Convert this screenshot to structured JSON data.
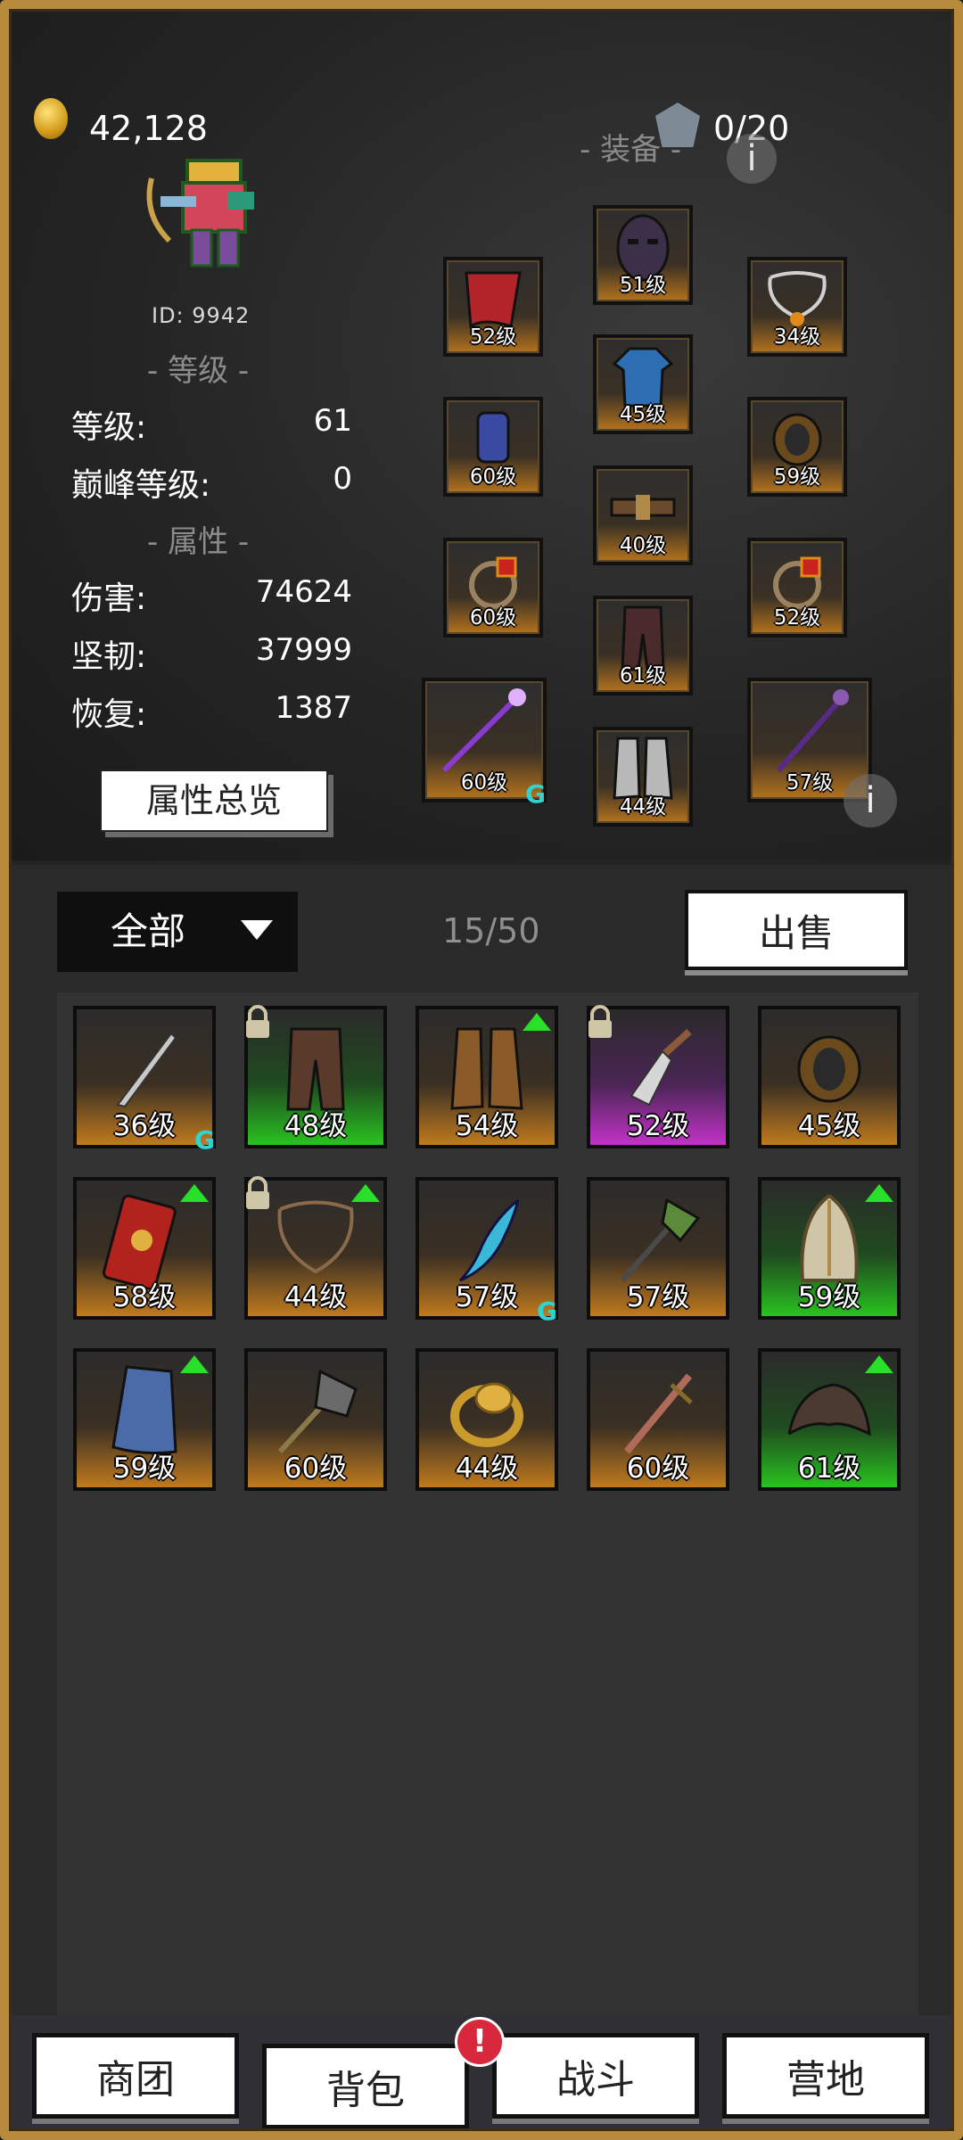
{
  "header": {
    "gold_amount": "42,128",
    "equip_title": "- 装备 -",
    "equip_count": "0/20",
    "player_id": "ID: 9942"
  },
  "level_section": {
    "title": "- 等级 -",
    "rows": [
      {
        "label": "等级:",
        "value": "61"
      },
      {
        "label": "巅峰等级:",
        "value": "0"
      }
    ]
  },
  "attr_section": {
    "title": "- 属性 -",
    "rows": [
      {
        "label": "伤害:",
        "value": "74624"
      },
      {
        "label": "坚韧:",
        "value": "37999"
      },
      {
        "label": "恢复:",
        "value": "1387"
      }
    ],
    "overview_button": "属性总览"
  },
  "equipped": [
    {
      "slot": "cape",
      "level": "52级",
      "icon": "cape-icon"
    },
    {
      "slot": "helmet",
      "level": "51级",
      "icon": "mask-icon"
    },
    {
      "slot": "necklace",
      "level": "34级",
      "icon": "necklace-icon"
    },
    {
      "slot": "gloves",
      "level": "60级",
      "icon": "glove-icon"
    },
    {
      "slot": "armor",
      "level": "45级",
      "icon": "robe-icon"
    },
    {
      "slot": "bracer",
      "level": "59级",
      "icon": "bracer-icon"
    },
    {
      "slot": "ring-left",
      "level": "60级",
      "icon": "ring-icon"
    },
    {
      "slot": "belt",
      "level": "40级",
      "icon": "belt-icon"
    },
    {
      "slot": "ring-right",
      "level": "52级",
      "icon": "ring-icon"
    },
    {
      "slot": "pants",
      "level": "61级",
      "icon": "pants-icon"
    },
    {
      "slot": "weapon-left",
      "level": "60级",
      "icon": "staff-icon"
    },
    {
      "slot": "boots",
      "level": "44级",
      "icon": "boots-icon"
    },
    {
      "slot": "weapon-right",
      "level": "57级",
      "icon": "staff-icon"
    }
  ],
  "bag": {
    "filter_label": "全部",
    "count": "15/50",
    "sell_button": "出售",
    "items": [
      {
        "level": "36级",
        "rarity": "orange",
        "icon": "dagger-icon",
        "g": true
      },
      {
        "level": "48级",
        "rarity": "green",
        "icon": "pants-icon",
        "locked": true
      },
      {
        "level": "54级",
        "rarity": "orange",
        "icon": "boots-icon",
        "up": true
      },
      {
        "level": "52级",
        "rarity": "purple",
        "icon": "spear-head-icon",
        "locked": true
      },
      {
        "level": "45级",
        "rarity": "orange",
        "icon": "bracer-icon"
      },
      {
        "level": "58级",
        "rarity": "orange",
        "icon": "shield-icon",
        "up": true
      },
      {
        "level": "44级",
        "rarity": "orange",
        "icon": "necklace-icon",
        "locked": true,
        "up": true
      },
      {
        "level": "57级",
        "rarity": "orange",
        "icon": "scimitar-icon",
        "g": true
      },
      {
        "level": "57级",
        "rarity": "orange",
        "icon": "axe-icon"
      },
      {
        "level": "59级",
        "rarity": "green",
        "icon": "helmet-icon",
        "up": true
      },
      {
        "level": "59级",
        "rarity": "orange",
        "icon": "cloak-icon",
        "up": true
      },
      {
        "level": "60级",
        "rarity": "orange",
        "icon": "mace-icon"
      },
      {
        "level": "44级",
        "rarity": "orange",
        "icon": "ring-icon"
      },
      {
        "level": "60级",
        "rarity": "orange",
        "icon": "sword-icon"
      },
      {
        "level": "61级",
        "rarity": "green",
        "icon": "shoulder-icon",
        "up": true
      }
    ]
  },
  "nav": {
    "items": [
      "商团",
      "背包",
      "战斗",
      "营地"
    ],
    "badge": "!"
  },
  "colors": {
    "gold_border": "#b88a3c",
    "rarity_orange": "#c07a1e",
    "rarity_green": "#29c21f",
    "rarity_purple": "#c232c8",
    "upgrade_arrow": "#28e028",
    "badge_red": "#d8283b"
  }
}
